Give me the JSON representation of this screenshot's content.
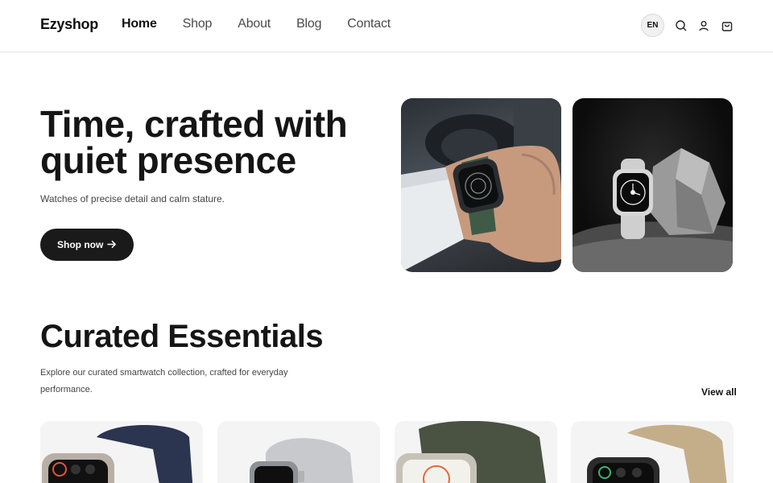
{
  "header": {
    "logo": "Ezyshop",
    "nav": [
      "Home",
      "Shop",
      "About",
      "Blog",
      "Contact"
    ],
    "active_nav": "Home",
    "lang": "EN",
    "icons": [
      "search-icon",
      "user-icon",
      "cart-icon"
    ]
  },
  "hero": {
    "title": "Time, crafted with quiet presence",
    "subtitle": "Watches of precise detail and calm stature.",
    "cta_label": "Shop now"
  },
  "essentials": {
    "title": "Curated Essentials",
    "description": "Explore our curated smartwatch collection, crafted for everyday performance.",
    "view_all": "View all"
  },
  "colors": {
    "accent": "#1a1a1a",
    "background": "#ffffff",
    "card": "#f4f4f4"
  }
}
